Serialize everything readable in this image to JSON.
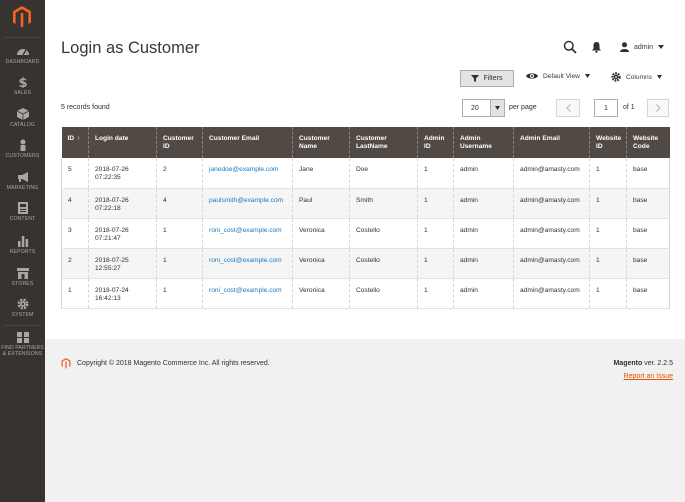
{
  "sidebar": {
    "items": [
      {
        "label": "Dashboard",
        "icon": "dashboard-icon"
      },
      {
        "label": "Sales",
        "icon": "dollar-icon"
      },
      {
        "label": "Catalog",
        "icon": "box-icon"
      },
      {
        "label": "Customers",
        "icon": "person-icon"
      },
      {
        "label": "Marketing",
        "icon": "megaphone-icon"
      },
      {
        "label": "Content",
        "icon": "content-icon"
      },
      {
        "label": "Reports",
        "icon": "bar-chart-icon"
      },
      {
        "label": "Stores",
        "icon": "store-icon"
      },
      {
        "label": "System",
        "icon": "gear-icon"
      },
      {
        "label": "Find Partners",
        "label2": "& Extensions",
        "icon": "partners-icon"
      }
    ]
  },
  "header": {
    "title": "Login as Customer",
    "user": "admin"
  },
  "toolbar": {
    "filters": "Filters",
    "view": "Default View",
    "columns": "Columns"
  },
  "pagination": {
    "records": "5 records found",
    "per_page_value": "20",
    "per_page_label": "per page",
    "current_page": "1",
    "of_label": "of 1"
  },
  "table": {
    "headers": [
      [
        "ID",
        ""
      ],
      [
        "Login date",
        ""
      ],
      [
        "Customer",
        "ID"
      ],
      [
        "Customer Email",
        ""
      ],
      [
        "Customer",
        "Name"
      ],
      [
        "Customer",
        "LastName"
      ],
      [
        "Admin",
        "ID"
      ],
      [
        "Admin",
        "Username"
      ],
      [
        "Admin Email",
        ""
      ],
      [
        "Website",
        "ID"
      ],
      [
        "Website",
        "Code"
      ]
    ],
    "rows": [
      [
        "5",
        "2018-07-26",
        "07:22:35",
        "2",
        "janedoe@example.com",
        "Jane",
        "Doe",
        "1",
        "admin",
        "admin@amasty.com",
        "1",
        "base"
      ],
      [
        "4",
        "2018-07-26",
        "07:22:18",
        "4",
        "paulsmith@example.com",
        "Paul",
        "Smith",
        "1",
        "admin",
        "admin@amasty.com",
        "1",
        "base"
      ],
      [
        "3",
        "2018-07-26",
        "07:21:47",
        "1",
        "roni_cost@example.com",
        "Veronica",
        "Costello",
        "1",
        "admin",
        "admin@amasty.com",
        "1",
        "base"
      ],
      [
        "2",
        "2018-07-25",
        "12:55:27",
        "1",
        "roni_cost@example.com",
        "Veronica",
        "Costello",
        "1",
        "admin",
        "admin@amasty.com",
        "1",
        "base"
      ],
      [
        "1",
        "2018-07-24",
        "16:42:13",
        "1",
        "roni_cost@example.com",
        "Veronica",
        "Costello",
        "1",
        "admin",
        "admin@amasty.com",
        "1",
        "base"
      ]
    ]
  },
  "footer": {
    "copyright": "Copyright © 2018 Magento Commerce Inc. All rights reserved.",
    "brand": "Magento",
    "version": " ver. 2.2.5",
    "report": "Report an Issue"
  },
  "colors": {
    "sidebar_bg": "#373330",
    "header_row_bg": "#514943",
    "accent": "#eb5202",
    "link": "#1979c3"
  }
}
